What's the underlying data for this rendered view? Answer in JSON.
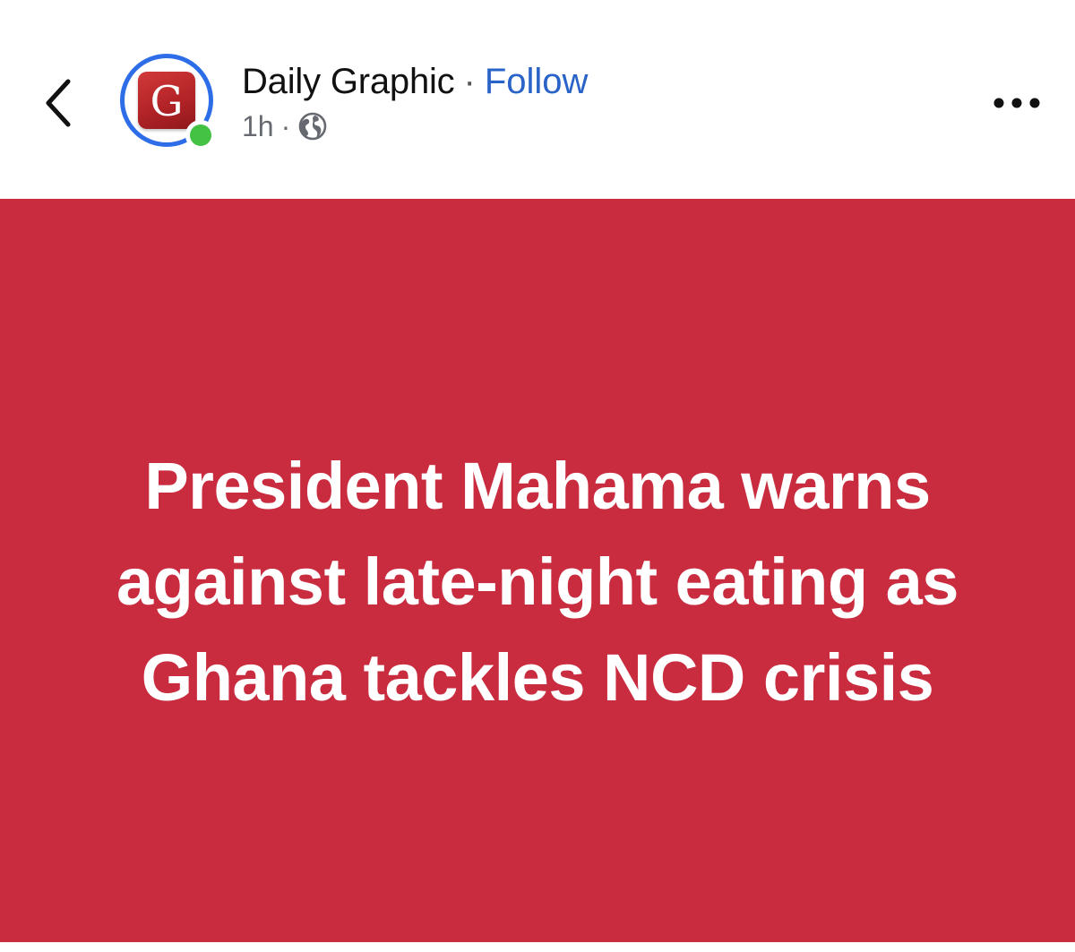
{
  "post": {
    "page_name": "Daily Graphic",
    "separator": "·",
    "follow_label": "Follow",
    "timestamp": "1h",
    "meta_separator": "·",
    "privacy_icon": "globe-icon",
    "avatar_letter": "G",
    "online_status_color": "#44c244",
    "story_ring_color": "#2d6ee8"
  },
  "nav": {
    "back_icon": "chevron-left-icon",
    "more_icon": "more-horizontal-icon"
  },
  "card": {
    "background_color": "#c92b3f",
    "text_color": "#ffffff",
    "headline": "President Mahama warns against late-night eating as Ghana tackles NCD crisis"
  }
}
